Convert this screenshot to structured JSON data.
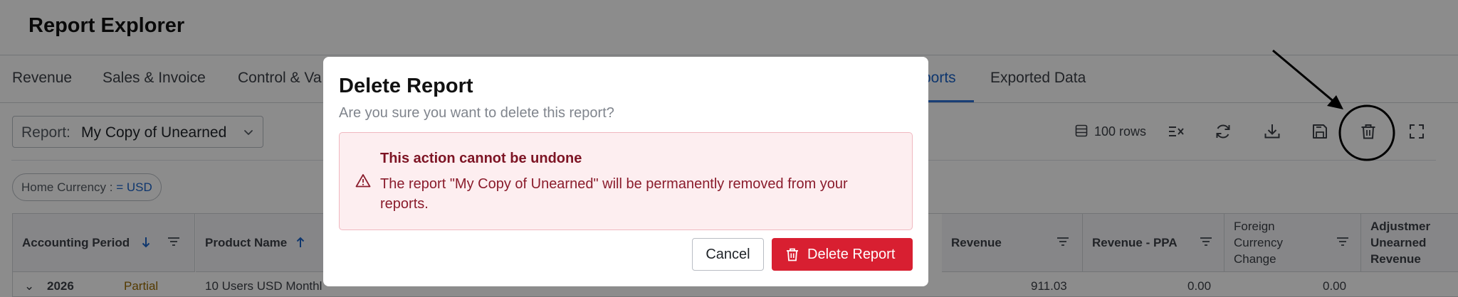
{
  "app": {
    "title": "Report Explorer"
  },
  "tabs": [
    {
      "label": "Revenue"
    },
    {
      "label": "Sales & Invoice"
    },
    {
      "label": "Control & Va"
    },
    {
      "label": "ports",
      "active": true
    },
    {
      "label": "Exported Data"
    }
  ],
  "toolbar": {
    "report_label": "Report:",
    "report_value": "My Copy of Unearned",
    "rows": "100 rows",
    "icons": [
      "table-rows-icon",
      "clear-columns-icon",
      "refresh-icon",
      "download-icon",
      "save-icon",
      "trash-icon",
      "fullscreen-icon"
    ]
  },
  "filters": [
    {
      "key": "Home Currency : ",
      "value": "= USD"
    }
  ],
  "table": {
    "columns": [
      {
        "label": "Accounting Period",
        "sort": "desc"
      },
      {
        "label": "Product Name",
        "sort": "asc"
      },
      {
        "label": "Revenue"
      },
      {
        "label": "Revenue - PPA"
      },
      {
        "label": "Foreign Currency Change"
      },
      {
        "label": "Adjustmer Unearned Revenue"
      }
    ],
    "first_row": {
      "period": "2026",
      "status": "Partial",
      "product": "10 Users USD Monthl",
      "revenue": "911.03",
      "revenue_ppa": "0.00",
      "fx_change": "0.00"
    }
  },
  "modal": {
    "title": "Delete Report",
    "subtitle": "Are you sure you want to delete this report?",
    "alert_title": "This action cannot be undone",
    "alert_body": "The report \"My Copy of Unearned\" will be permanently removed from your reports.",
    "cancel_label": "Cancel",
    "delete_label": "Delete Report"
  },
  "colors": {
    "accent": "#1a63c9",
    "danger": "#d81f31",
    "alert_bg": "#fdeef0",
    "alert_text": "#7d1424"
  }
}
